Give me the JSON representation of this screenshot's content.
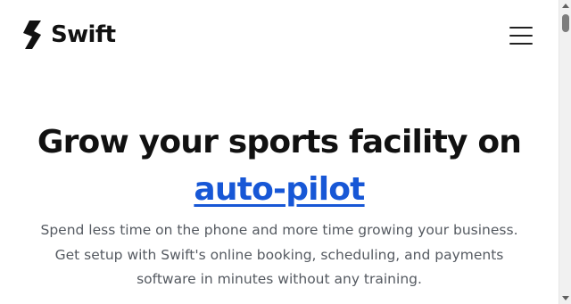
{
  "header": {
    "brand_name": "Swift",
    "logo_icon": "swift-s-logo-icon",
    "menu_icon": "hamburger-menu-icon"
  },
  "hero": {
    "title_line1": "Grow your sports facility on",
    "title_accent": "auto-pilot",
    "subtitle_lines": [
      "Spend less time on the phone and more time growing your business.",
      "Get setup with Swift's online booking, scheduling, and payments",
      "software in minutes without any training."
    ]
  },
  "colors": {
    "accent": "#1757d6",
    "text": "#111111",
    "muted": "#555a61"
  }
}
